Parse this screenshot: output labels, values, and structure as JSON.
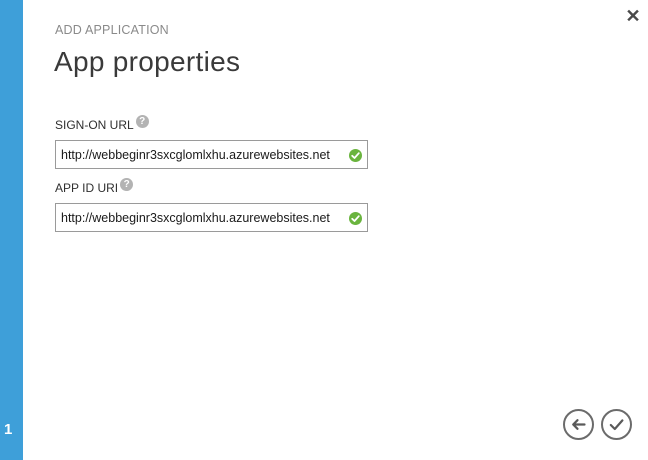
{
  "wizard": {
    "step": "1",
    "eyebrow": "ADD APPLICATION",
    "title": "App properties",
    "close_icon": "close-icon",
    "close_glyph": "✕"
  },
  "fields": {
    "sign_on_url": {
      "label": "SIGN-ON URL",
      "value": "http://webbeginr3sxcglomlxhu.azurewebsites.net",
      "help_icon": "help-icon",
      "help_glyph": "?",
      "status_icon": "valid-check-icon"
    },
    "app_id_uri": {
      "label": "APP ID URI",
      "value": "http://webbeginr3sxcglomlxhu.azurewebsites.net",
      "help_icon": "help-icon",
      "help_glyph": "?",
      "status_icon": "valid-check-icon"
    }
  },
  "footer": {
    "back_icon": "arrow-left-icon",
    "finish_icon": "checkmark-icon"
  },
  "colors": {
    "accent": "#3e9fd9",
    "valid": "#6ab43e",
    "help": "#b3b3b3"
  }
}
